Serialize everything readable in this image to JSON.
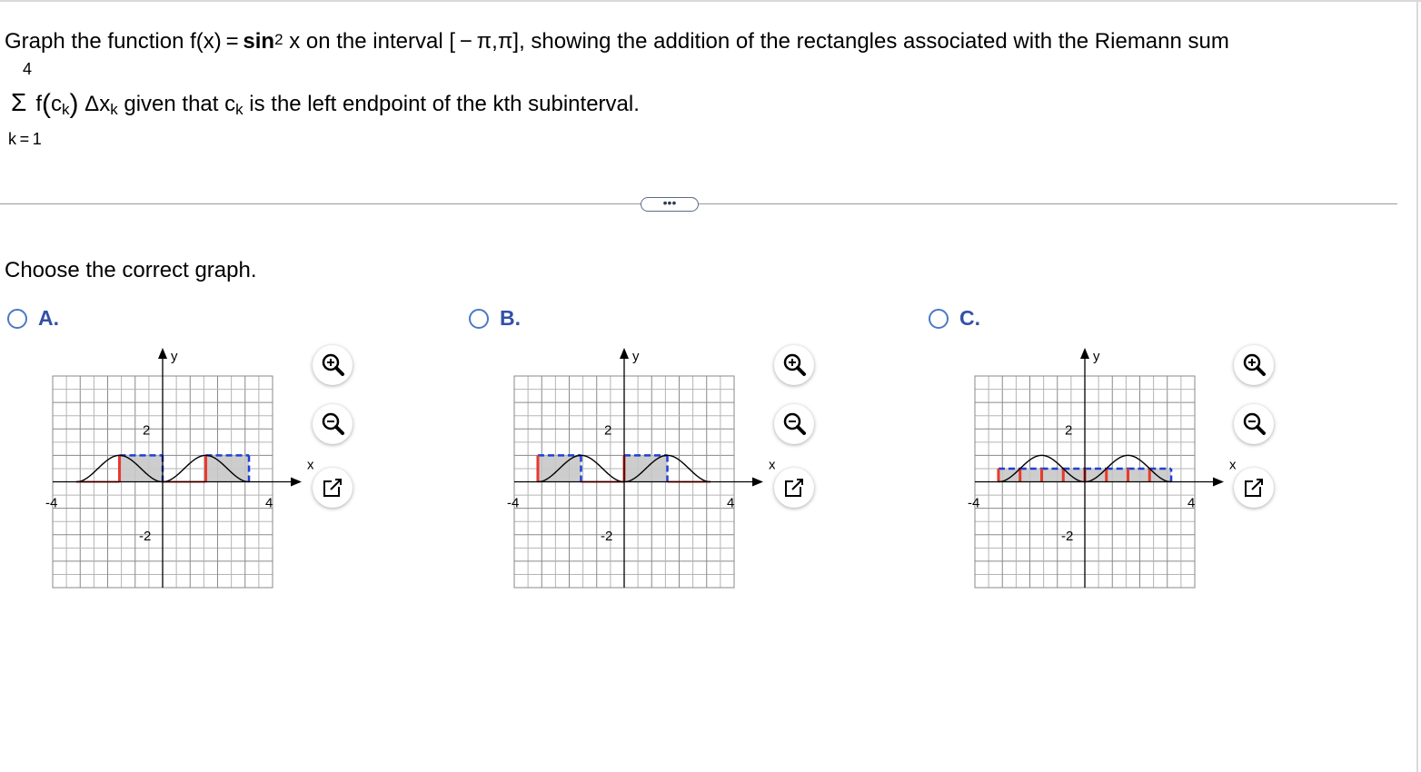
{
  "question": {
    "text_before": "Graph the function f(x) = ",
    "func_bold": "sin",
    "exponent": "2",
    "text_after": " x on the interval [ − π,π], showing the addition of the rectangles associated with the Riemann sum",
    "sum_upper": "4",
    "sigma": "Σ",
    "f_open": "f",
    "c": "c",
    "k_sub": "k",
    "delta_x": "Δx",
    "text_end": " given that c",
    "text_end2": " is the left endpoint of the kth subinterval.",
    "sum_lower": "k = 1"
  },
  "more_button": "•••",
  "prompt": "Choose the correct graph.",
  "options": [
    {
      "letter": "A.",
      "x_label": "x",
      "y_label": "y",
      "tick_left": "-4",
      "tick_right": "4",
      "tick_top": "2",
      "tick_bottom": "-2"
    },
    {
      "letter": "B.",
      "x_label": "x",
      "y_label": "y",
      "tick_left": "-4",
      "tick_right": "4",
      "tick_top": "2",
      "tick_bottom": "-2"
    },
    {
      "letter": "C.",
      "x_label": "x",
      "y_label": "y",
      "tick_left": "-4",
      "tick_right": "4",
      "tick_top": "2",
      "tick_bottom": "-2"
    }
  ],
  "tools": [
    "zoom-in-icon",
    "zoom-out-icon",
    "popout-icon"
  ],
  "chart_data": [
    {
      "type": "line",
      "function": "sin^2 x",
      "domain": [
        -3.14159,
        3.14159
      ],
      "xlim": [
        -4,
        4
      ],
      "ylim": [
        -4,
        4
      ],
      "rectangles": [
        {
          "x0": -3.14159,
          "x1": -1.5708,
          "height": 0
        },
        {
          "x0": -1.5708,
          "x1": 0,
          "height": 1
        },
        {
          "x0": 0,
          "x1": 1.5708,
          "height": 0
        },
        {
          "x0": 1.5708,
          "x1": 3.14159,
          "height": 1
        }
      ],
      "colors": {
        "left_edge": "#e8392c",
        "right_edge": "#1f3fd6",
        "fill": "#c8c8c8"
      }
    },
    {
      "type": "line",
      "function": "sin^2 x",
      "domain": [
        -3.14159,
        3.14159
      ],
      "xlim": [
        -4,
        4
      ],
      "ylim": [
        -4,
        4
      ],
      "rectangles": [
        {
          "x0": -3.14159,
          "x1": -1.5708,
          "height": 1
        },
        {
          "x0": -1.5708,
          "x1": 0,
          "height": 0
        },
        {
          "x0": 0,
          "x1": 1.5708,
          "height": 1
        },
        {
          "x0": 1.5708,
          "x1": 3.14159,
          "height": 0
        }
      ],
      "colors": {
        "left_edge": "#e8392c",
        "right_edge": "#1f3fd6",
        "fill": "#c8c8c8"
      }
    },
    {
      "type": "line",
      "function": "sin^2 x",
      "domain": [
        -3.14159,
        3.14159
      ],
      "xlim": [
        -4,
        4
      ],
      "ylim": [
        -4,
        4
      ],
      "rectangles": [
        {
          "x0": -3.14159,
          "x1": -2.356,
          "height": 0.5
        },
        {
          "x0": -2.356,
          "x1": -1.5708,
          "height": 0.5
        },
        {
          "x0": -1.5708,
          "x1": -0.785,
          "height": 0.5
        },
        {
          "x0": -0.785,
          "x1": 0,
          "height": 0.5
        },
        {
          "x0": 0,
          "x1": 0.785,
          "height": 0.5
        },
        {
          "x0": 0.785,
          "x1": 1.5708,
          "height": 0.5
        },
        {
          "x0": 1.5708,
          "x1": 2.356,
          "height": 0.5
        },
        {
          "x0": 2.356,
          "x1": 3.14159,
          "height": 0.5
        }
      ],
      "colors": {
        "left_edge": "#e8392c",
        "right_edge": "#1f3fd6",
        "fill": "#c8c8c8"
      }
    }
  ]
}
